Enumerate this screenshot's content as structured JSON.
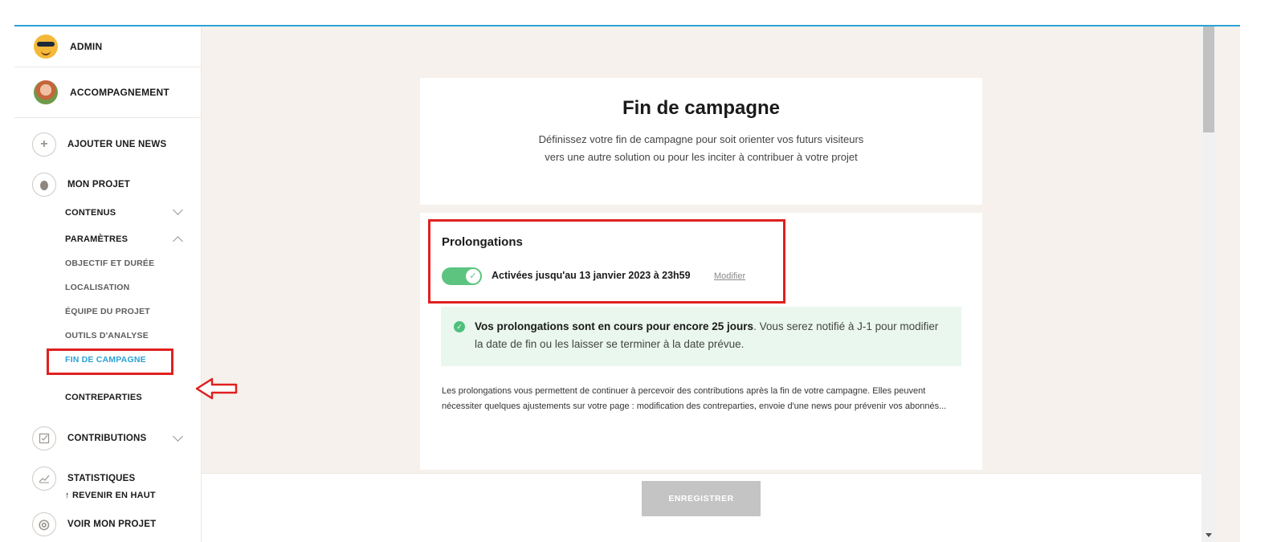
{
  "sidebar": {
    "user_role": "ADMIN",
    "support_label": "ACCOMPAGNEMENT",
    "add_news": "AJOUTER UNE NEWS",
    "project": "MON PROJET",
    "contenus": "CONTENUS",
    "parametres": "PARAMÈTRES",
    "params_items": [
      "OBJECTIF ET DURÉE",
      "LOCALISATION",
      "ÉQUIPE DU PROJET",
      "OUTILS D'ANALYSE",
      "FIN DE CAMPAGNE"
    ],
    "contreparties": "CONTREPARTIES",
    "contributions": "CONTRIBUTIONS",
    "statistiques": "STATISTIQUES",
    "back_to_top": "↑  REVENIR EN HAUT",
    "view_project": "VOIR MON PROJET"
  },
  "header": {
    "title": "Fin de campagne",
    "subtitle": "Définissez votre fin de campagne pour soit orienter vos futurs visiteurs vers une autre solution ou pour les inciter à contribuer à votre projet"
  },
  "extensions": {
    "title": "Prolongations",
    "toggle_on": true,
    "status": "Activées jusqu'au 13 janvier 2023 à 23h59",
    "modify": "Modifier",
    "info_bold": "Vos prolongations sont en cours pour encore 25 jours",
    "info_rest": ". Vous serez notifié à J-1 pour modifier la date de fin ou les laisser se terminer à la date prévue.",
    "description": "Les prolongations vous permettent de continuer à percevoir des contributions après la fin de votre campagne. Elles peuvent nécessiter quelques ajustements sur votre page : modification des contreparties, envoie d'une news pour prévenir vos abonnés..."
  },
  "footer": {
    "save": "ENREGISTRER"
  },
  "colors": {
    "accent": "#2aa2d5",
    "toggle": "#5cc47e",
    "highlight": "#e02020",
    "info_bg": "#eaf7ee"
  },
  "icons": {
    "admin_avatar": "sunglasses-emoji-icon",
    "add": "plus-icon",
    "project": "egg-icon",
    "contributions": "checkbox-icon",
    "stats": "chart-line-icon",
    "view": "eye-icon"
  }
}
